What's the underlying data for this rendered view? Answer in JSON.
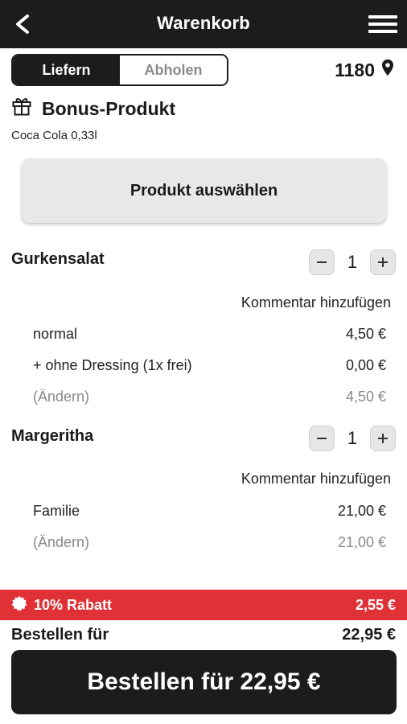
{
  "header": {
    "title": "Warenkorb",
    "back_icon": "back-arrow-icon",
    "menu_icon": "hamburger-menu-icon"
  },
  "delivery_toggle": {
    "deliver_label": "Liefern",
    "pickup_label": "Abholen",
    "selected": "Liefern"
  },
  "location": {
    "postal_code": "1180",
    "icon": "location-pin-icon"
  },
  "bonus": {
    "title": "Bonus-Produkt",
    "subtitle": "Coca Cola 0,33l",
    "icon": "gift-icon",
    "select_label": "Produkt auswählen"
  },
  "cart_items": [
    {
      "name": "Gurkensalat",
      "quantity": "1",
      "comment_label": "Kommentar hinzufügen",
      "lines": [
        {
          "label": "normal",
          "price": "4,50 €"
        },
        {
          "label": "+ ohne Dressing (1x frei)",
          "price": "0,00 €"
        }
      ],
      "change_label": "(Ändern)",
      "item_total": "4,50 €"
    },
    {
      "name": "Margeritha",
      "quantity": "1",
      "comment_label": "Kommentar hinzufügen",
      "lines": [
        {
          "label": "Familie",
          "price": "21,00 €"
        }
      ],
      "change_label": "(Ändern)",
      "item_total": "21,00 €"
    }
  ],
  "discount": {
    "label": "10% Rabatt",
    "amount": "2,55 €",
    "color": "#e03136",
    "icon": "badge-icon"
  },
  "total": {
    "label": "Bestellen für",
    "amount": "22,95 €"
  },
  "order_button": {
    "label": "Bestellen für 22,95 €"
  },
  "colors": {
    "dark": "#1c1c1c",
    "accent": "#e03136",
    "button_gray": "#e8e8e8",
    "muted_text": "#8a8a8a"
  }
}
